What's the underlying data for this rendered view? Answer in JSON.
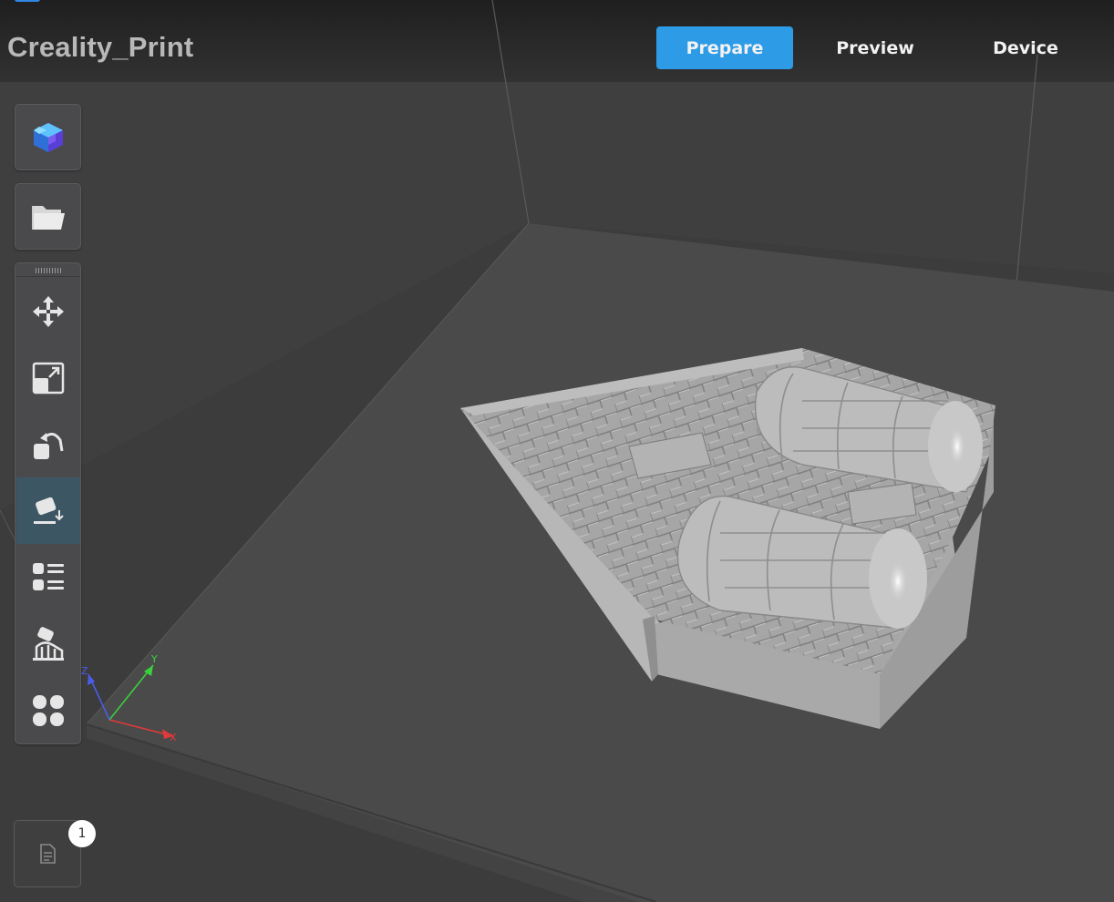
{
  "app": {
    "title": "Creality_Print"
  },
  "tabs": [
    {
      "label": "Prepare",
      "active": true
    },
    {
      "label": "Preview",
      "active": false
    },
    {
      "label": "Device",
      "active": false
    }
  ],
  "sidebar": {
    "top_buttons": [
      {
        "icon": "model-library-icon"
      },
      {
        "icon": "open-folder-icon"
      }
    ],
    "tools": [
      {
        "icon": "move-icon",
        "active": false
      },
      {
        "icon": "scale-icon",
        "active": false
      },
      {
        "icon": "rotate-icon",
        "active": false
      },
      {
        "icon": "lay-flat-icon",
        "active": true
      },
      {
        "icon": "object-list-icon",
        "active": false
      },
      {
        "icon": "support-icon",
        "active": false
      },
      {
        "icon": "arrange-icon",
        "active": false
      }
    ]
  },
  "axes": {
    "x": "X",
    "y": "Y",
    "z": "Z"
  },
  "messages": {
    "count": "1"
  },
  "colors": {
    "accent": "#2e9be6",
    "background": "#3d3d3e",
    "panel": "#4a4a4c",
    "bed": "#4a4a4b",
    "model": "#a8a8a8",
    "axis_x": "#e03a3a",
    "axis_y": "#3ad13a",
    "axis_z": "#4b5de8"
  }
}
